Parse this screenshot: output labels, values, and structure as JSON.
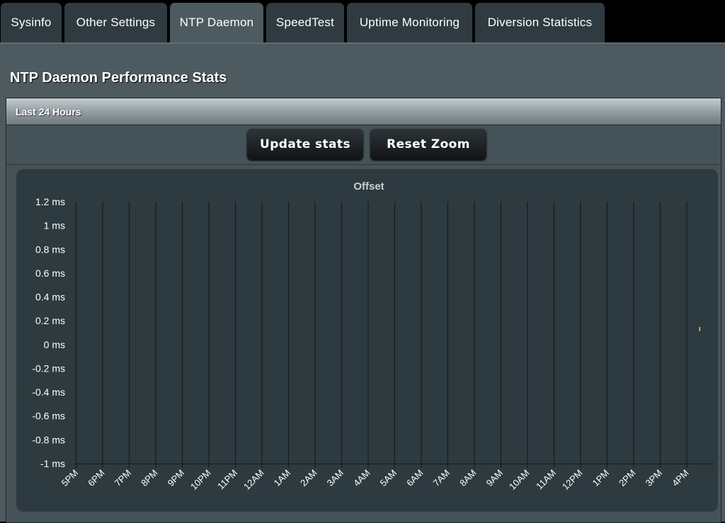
{
  "tabs": [
    {
      "label": "Sysinfo",
      "active": false
    },
    {
      "label": "Other Settings",
      "active": false
    },
    {
      "label": "NTP Daemon",
      "active": true
    },
    {
      "label": "SpeedTest",
      "active": false
    },
    {
      "label": "Uptime Monitoring",
      "active": false
    },
    {
      "label": "Diversion Statistics",
      "active": false
    }
  ],
  "page": {
    "title": "NTP Daemon Performance Stats",
    "section_title": "Last 24 Hours"
  },
  "buttons": {
    "update_stats": "Update stats",
    "reset_zoom": "Reset Zoom"
  },
  "colors": {
    "series": "#f0a030"
  },
  "chart_data": {
    "type": "line",
    "title": "Offset",
    "ylabel": "",
    "xlabel": "",
    "y_unit": "ms",
    "ylim": [
      -1,
      1.2
    ],
    "y_ticks": [
      1.2,
      1,
      0.8,
      0.6,
      0.4,
      0.2,
      0,
      -0.2,
      -0.4,
      -0.6,
      -0.8,
      -1
    ],
    "y_tick_labels": [
      "1.2 ms",
      "1 ms",
      "0.8 ms",
      "0.6 ms",
      "0.4 ms",
      "0.2 ms",
      "0 ms",
      "-0.2 ms",
      "-0.4 ms",
      "-0.6 ms",
      "-0.8 ms",
      "-1 ms"
    ],
    "x_tick_labels": [
      "5PM",
      "6PM",
      "7PM",
      "8PM",
      "9PM",
      "10PM",
      "11PM",
      "12AM",
      "1AM",
      "2AM",
      "3AM",
      "4AM",
      "5AM",
      "6AM",
      "7AM",
      "8AM",
      "9AM",
      "10AM",
      "11AM",
      "12PM",
      "1PM",
      "2PM",
      "3PM",
      "4PM"
    ],
    "x_grid": true,
    "y_grid": false,
    "series": [
      {
        "values": [
          {
            "x": "4:30PM",
            "y": 0.13
          }
        ]
      }
    ]
  }
}
